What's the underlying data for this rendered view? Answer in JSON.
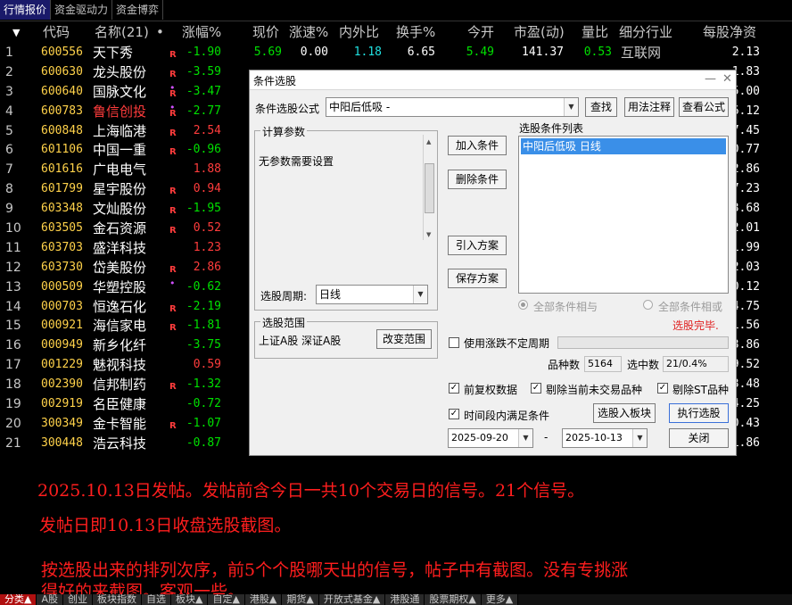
{
  "top_tabs": [
    "行情报价",
    "资金驱动力",
    "资金博弈"
  ],
  "table": {
    "headers": {
      "sort": "▼",
      "code": "代码",
      "name": "名称(21)",
      "dot": "•",
      "chg": "涨幅%",
      "price": "现价",
      "speed": "涨速%",
      "io": "内外比",
      "turnover": "换手%",
      "open": "今开",
      "pe": "市盈(动)",
      "vr": "量比",
      "industry": "细分行业",
      "nav": "每股净资"
    },
    "rows": [
      {
        "idx": "1",
        "code": "600556",
        "name": "天下秀",
        "r": "R",
        "dot": "",
        "chg": "-1.90",
        "price": "5.69",
        "speed": "0.00",
        "io": "1.18",
        "turn": "6.65",
        "open": "5.49",
        "pe": "141.37",
        "vr": "0.53",
        "ind": "互联网",
        "nav": "2.13"
      },
      {
        "idx": "2",
        "code": "600630",
        "name": "龙头股份",
        "r": "R",
        "dot": "",
        "chg": "-3.59",
        "price": "",
        "speed": "",
        "io": "",
        "turn": "",
        "open": "",
        "pe": "",
        "vr": "",
        "ind": "",
        "nav": "1.83"
      },
      {
        "idx": "3",
        "code": "600640",
        "name": "国脉文化",
        "r": "R",
        "dot": "•",
        "chg": "-3.47",
        "price": "",
        "speed": "",
        "io": "",
        "turn": "",
        "open": "",
        "pe": "",
        "vr": "",
        "ind": "",
        "nav": "5.00"
      },
      {
        "idx": "4",
        "code": "600783",
        "name": "鲁信创投",
        "r": "R",
        "dot": "•",
        "chg": "-2.77",
        "price": "",
        "speed": "",
        "io": "",
        "turn": "",
        "open": "",
        "pe": "",
        "vr": "",
        "ind": "",
        "nav": "6.12"
      },
      {
        "idx": "5",
        "code": "600848",
        "name": "上海临港",
        "r": "R",
        "dot": "",
        "chg": "2.54",
        "price": "",
        "speed": "",
        "io": "",
        "turn": "",
        "open": "",
        "pe": "",
        "vr": "",
        "ind": "",
        "nav": "7.45"
      },
      {
        "idx": "6",
        "code": "601106",
        "name": "中国一重",
        "r": "R",
        "dot": "",
        "chg": "-0.96",
        "price": "",
        "speed": "",
        "io": "",
        "turn": "",
        "open": "",
        "pe": "",
        "vr": "",
        "ind": "",
        "nav": "0.77"
      },
      {
        "idx": "7",
        "code": "601616",
        "name": "广电电气",
        "r": "",
        "dot": "",
        "chg": "1.88",
        "price": "",
        "speed": "",
        "io": "",
        "turn": "",
        "open": "",
        "pe": "",
        "vr": "",
        "ind": "",
        "nav": "2.86"
      },
      {
        "idx": "8",
        "code": "601799",
        "name": "星宇股份",
        "r": "R",
        "dot": "",
        "chg": "0.94",
        "price": "",
        "speed": "",
        "io": "",
        "turn": "",
        "open": "",
        "pe": "",
        "vr": "",
        "ind": "",
        "nav": "7.23"
      },
      {
        "idx": "9",
        "code": "603348",
        "name": "文灿股份",
        "r": "R",
        "dot": "",
        "chg": "-1.95",
        "price": "",
        "speed": "",
        "io": "",
        "turn": "",
        "open": "",
        "pe": "",
        "vr": "",
        "ind": "",
        "nav": "3.68"
      },
      {
        "idx": "10",
        "code": "603505",
        "name": "金石资源",
        "r": "R",
        "dot": "",
        "chg": "0.52",
        "price": "",
        "speed": "",
        "io": "",
        "turn": "",
        "open": "",
        "pe": "",
        "vr": "",
        "ind": "",
        "nav": "2.01"
      },
      {
        "idx": "11",
        "code": "603703",
        "name": "盛洋科技",
        "r": "",
        "dot": "",
        "chg": "1.23",
        "price": "",
        "speed": "",
        "io": "",
        "turn": "",
        "open": "",
        "pe": "",
        "vr": "",
        "ind": "",
        "nav": "1.99"
      },
      {
        "idx": "12",
        "code": "603730",
        "name": "岱美股份",
        "r": "R",
        "dot": "",
        "chg": "2.86",
        "price": "",
        "speed": "",
        "io": "",
        "turn": "",
        "open": "",
        "pe": "",
        "vr": "",
        "ind": "",
        "nav": "2.03"
      },
      {
        "idx": "13",
        "code": "000509",
        "name": "华塑控股",
        "r": "",
        "dot": "•",
        "chg": "-0.62",
        "price": "",
        "speed": "",
        "io": "",
        "turn": "",
        "open": "",
        "pe": "",
        "vr": "",
        "ind": "",
        "nav": "0.12"
      },
      {
        "idx": "14",
        "code": "000703",
        "name": "恒逸石化",
        "r": "R",
        "dot": "",
        "chg": "-2.19",
        "price": "",
        "speed": "",
        "io": "",
        "turn": "",
        "open": "",
        "pe": "",
        "vr": "",
        "ind": "",
        "nav": "4.75"
      },
      {
        "idx": "15",
        "code": "000921",
        "name": "海信家电",
        "r": "R",
        "dot": "",
        "chg": "-1.81",
        "price": "",
        "speed": "",
        "io": "",
        "turn": "",
        "open": "",
        "pe": "",
        "vr": "",
        "ind": "",
        "nav": "1.56"
      },
      {
        "idx": "16",
        "code": "000949",
        "name": "新乡化纤",
        "r": "",
        "dot": "",
        "chg": "-3.75",
        "price": "",
        "speed": "",
        "io": "",
        "turn": "",
        "open": "",
        "pe": "",
        "vr": "",
        "ind": "",
        "nav": "3.86"
      },
      {
        "idx": "17",
        "code": "001229",
        "name": "魅视科技",
        "r": "",
        "dot": "",
        "chg": "0.59",
        "price": "",
        "speed": "",
        "io": "",
        "turn": "",
        "open": "",
        "pe": "",
        "vr": "",
        "ind": "",
        "nav": "9.52"
      },
      {
        "idx": "18",
        "code": "002390",
        "name": "信邦制药",
        "r": "R",
        "dot": "",
        "chg": "-1.32",
        "price": "",
        "speed": "",
        "io": "",
        "turn": "",
        "open": "",
        "pe": "",
        "vr": "",
        "ind": "",
        "nav": "3.48"
      },
      {
        "idx": "19",
        "code": "002919",
        "name": "名臣健康",
        "r": "",
        "dot": "",
        "chg": "-0.72",
        "price": "",
        "speed": "",
        "io": "",
        "turn": "",
        "open": "",
        "pe": "",
        "vr": "",
        "ind": "",
        "nav": "4.25"
      },
      {
        "idx": "20",
        "code": "300349",
        "name": "金卡智能",
        "r": "R",
        "dot": "",
        "chg": "-1.07",
        "price": "",
        "speed": "",
        "io": "",
        "turn": "",
        "open": "",
        "pe": "",
        "vr": "",
        "ind": "",
        "nav": "0.43"
      },
      {
        "idx": "21",
        "code": "300448",
        "name": "浩云科技",
        "r": "",
        "dot": "",
        "chg": "-0.87",
        "price": "",
        "speed": "",
        "io": "",
        "turn": "",
        "open": "",
        "pe": "",
        "vr": "",
        "ind": "",
        "nav": "1.86"
      }
    ]
  },
  "dialog": {
    "title": "条件选股",
    "formula_label": "条件选股公式",
    "formula_value": "中阳后低吸  -",
    "find_button": "查找",
    "usage_button": "用法注释",
    "view_formula_button": "查看公式",
    "params_group": "计算参数",
    "params_text": "无参数需要设置",
    "add_condition": "加入条件",
    "delete_condition": "删除条件",
    "import_plan": "引入方案",
    "save_plan": "保存方案",
    "condition_list_label": "选股条件列表",
    "condition_item": "中阳后低吸  日线",
    "period_label": "选股周期:",
    "period_value": "日线",
    "all_and": "全部条件相与",
    "all_or": "全部条件相或",
    "done_text": "选股完毕.",
    "range_group": "选股范围",
    "range_text": "上证A股 深证A股",
    "change_range": "改变范围",
    "use_variable_period": "使用涨跌不定周期",
    "count_label": "品种数",
    "count_value": "5164",
    "selected_label": "选中数",
    "selected_value": "21/0.4%",
    "pre_adjust": "前复权数据",
    "exclude_untraded": "剔除当前未交易品种",
    "exclude_st": "剔除ST品种",
    "time_condition": "时间段内满足条件",
    "add_to_block": "选股入板块",
    "execute": "执行选股",
    "date_from": "2025-09-20",
    "date_sep": "-",
    "date_to": "2025-10-13",
    "close": "关闭",
    "ctl_min": "—",
    "ctl_close": "✕"
  },
  "notes": [
    "2025.10.13日发帖。发帖前含今日一共10个交易日的信号。21个信号。",
    "发帖日即10.13日收盘选股截图。",
    "按选股出来的排列次序，前5个个股哪天出的信号，帖子中有截图。没有专挑涨",
    "得好的来截图。客观一些。"
  ],
  "bottom_tabs": [
    "分类▲",
    "A股",
    "创业",
    "板块指数",
    "自选",
    "板块▲",
    "自定▲",
    "港股▲",
    "期货▲",
    "开放式基金▲",
    "港股通",
    "股票期权▲",
    "更多▲"
  ],
  "colors": {
    "up": "#ff3c3c",
    "down": "#00e000",
    "code": "#ffd24a",
    "note": "#ff1e1e"
  }
}
